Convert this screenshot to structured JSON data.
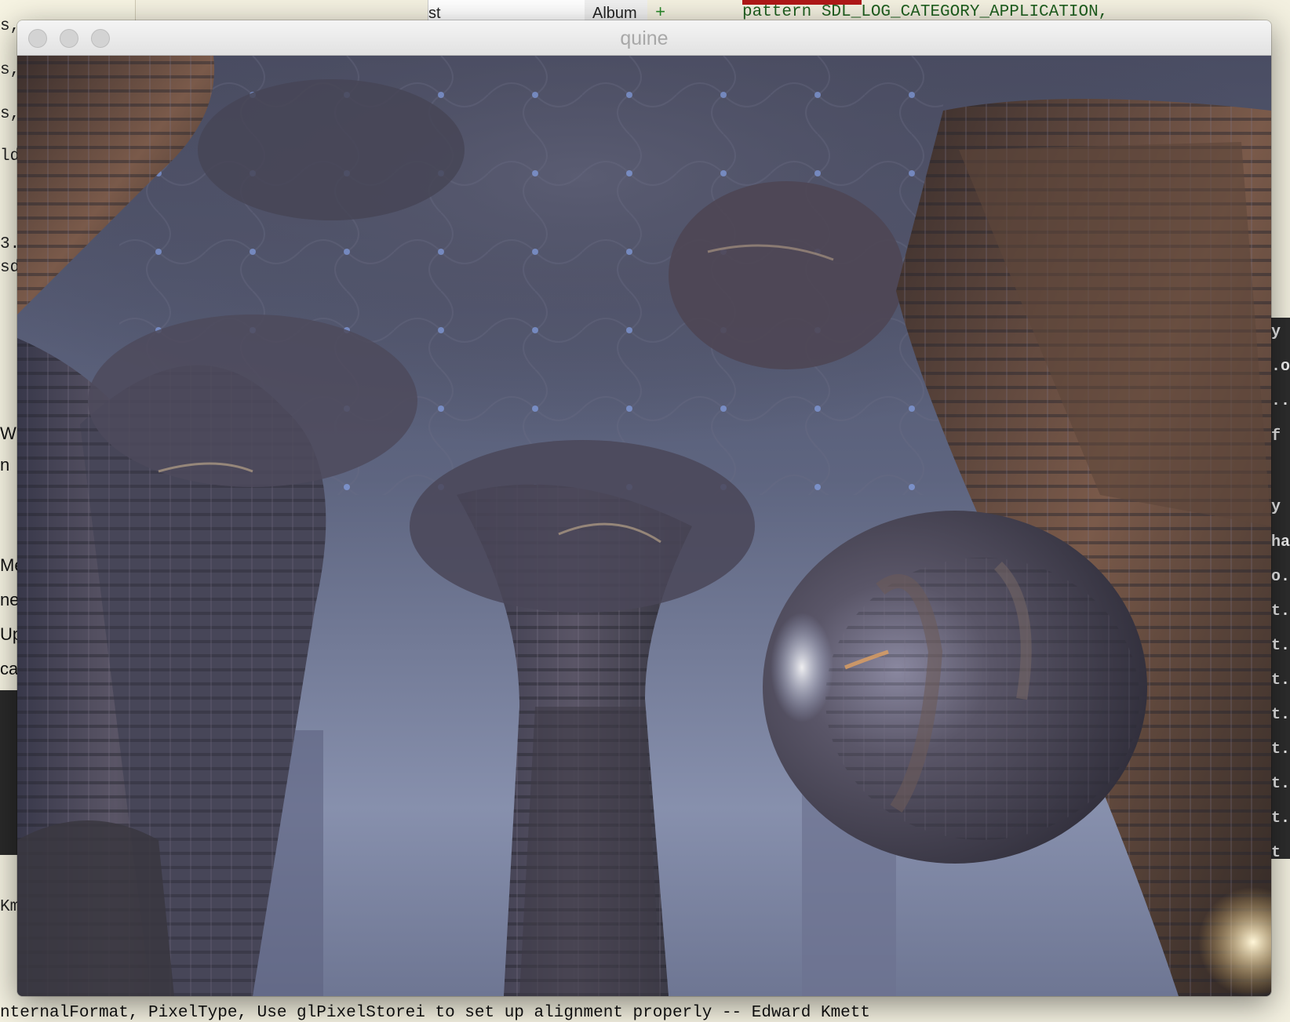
{
  "window": {
    "title": "quine"
  },
  "background": {
    "left_code_lines": [
      "s,",
      "s,",
      "s,",
      "ld",
      "3.",
      "sd"
    ],
    "left_ui_lines": [
      "W",
      "n",
      "Me",
      "ne",
      "Up",
      "ca",
      "Km"
    ],
    "finder_tab_text": "st",
    "album_label": "Album",
    "plus_sign": "+",
    "top_code": "pattern SDL_LOG_CATEGORY_APPLICATION,",
    "right_code_lines": [
      "y",
      ".o",
      "..",
      "f",
      "y",
      "ha",
      "o.",
      "t.",
      "t.",
      "t.",
      "t.",
      "t.",
      "t.",
      "t.",
      "t"
    ],
    "bottom_code": "nternalFormat, PixelType, Use glPixelStorei to set up alignment properly -- Edward Kmett"
  },
  "colors": {
    "scene_sky": "#6f7898",
    "scene_rock": "#4a4758",
    "scene_rust": "#6a4a3a",
    "sphere": "#55536a",
    "titlebar": "#e6e6e6",
    "title_text": "#a8a8a8"
  }
}
